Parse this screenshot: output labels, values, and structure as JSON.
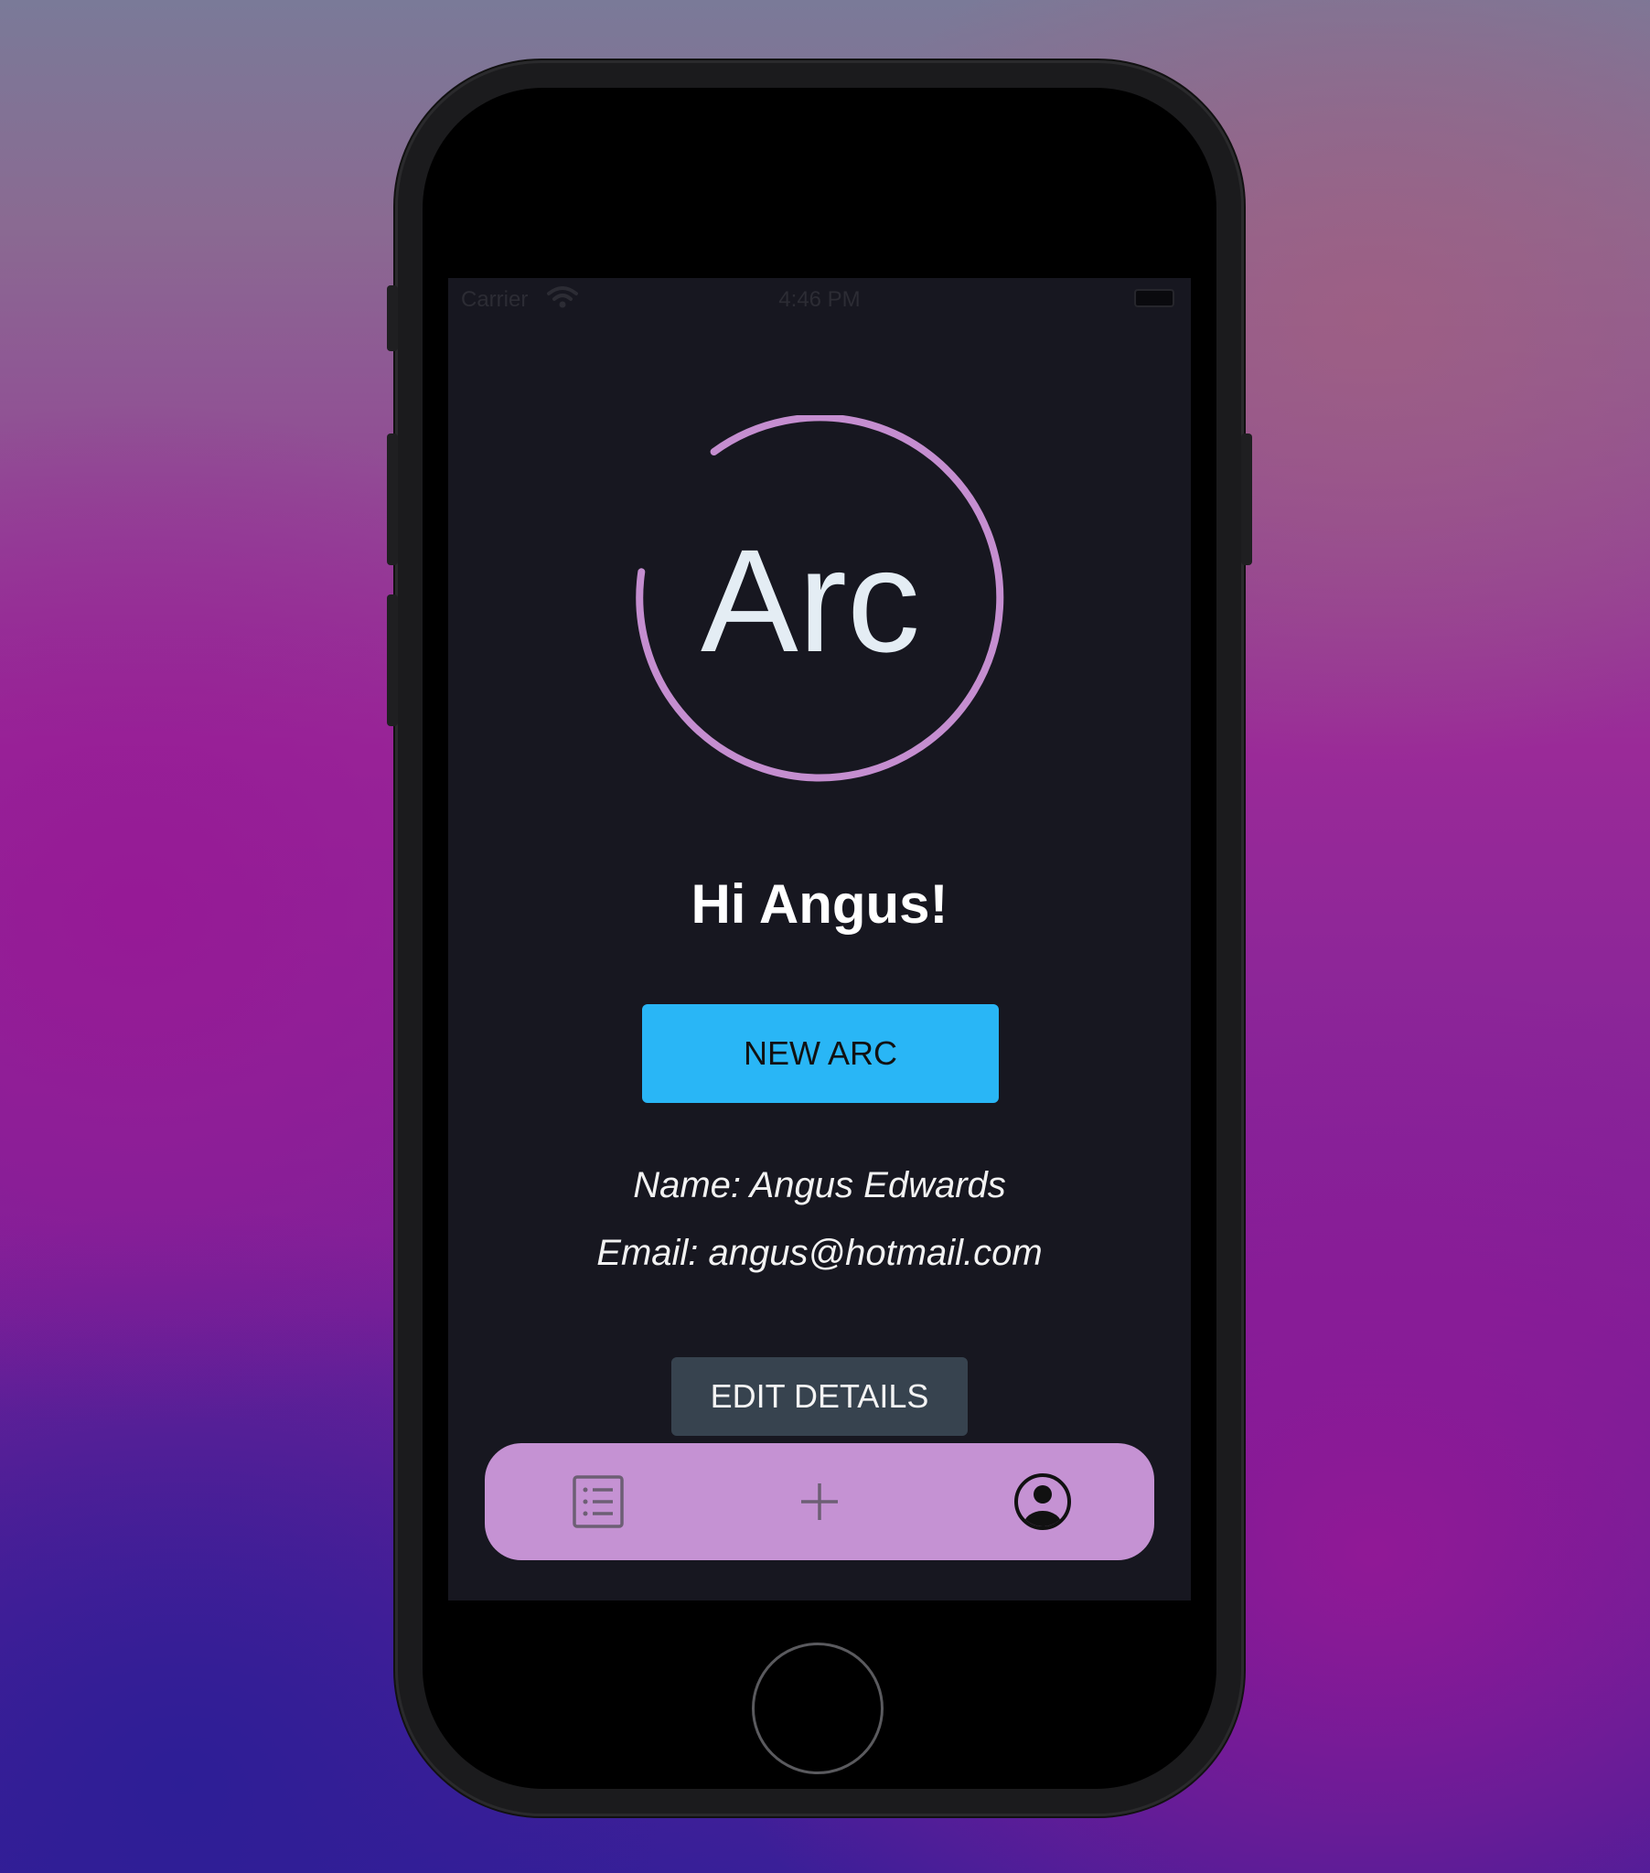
{
  "status_bar": {
    "carrier": "Carrier",
    "time": "4:46 PM"
  },
  "logo": {
    "text": "Arc",
    "ring_color": "#c58ed0",
    "text_color": "#e4edf4"
  },
  "greeting": "Hi Angus!",
  "new_arc_button": "NEW ARC",
  "profile": {
    "name_line": "Name: Angus Edwards",
    "email_line": "Email: angus@hotmail.com"
  },
  "edit_details_button": "EDIT DETAILS",
  "tab_bar": {
    "background": "#c592d3",
    "tabs": [
      {
        "icon": "list-icon"
      },
      {
        "icon": "plus-icon"
      },
      {
        "icon": "profile-icon"
      }
    ]
  },
  "colors": {
    "screen_background": "#171720",
    "primary_button": "#29b6f6",
    "secondary_button": "#37434f"
  }
}
